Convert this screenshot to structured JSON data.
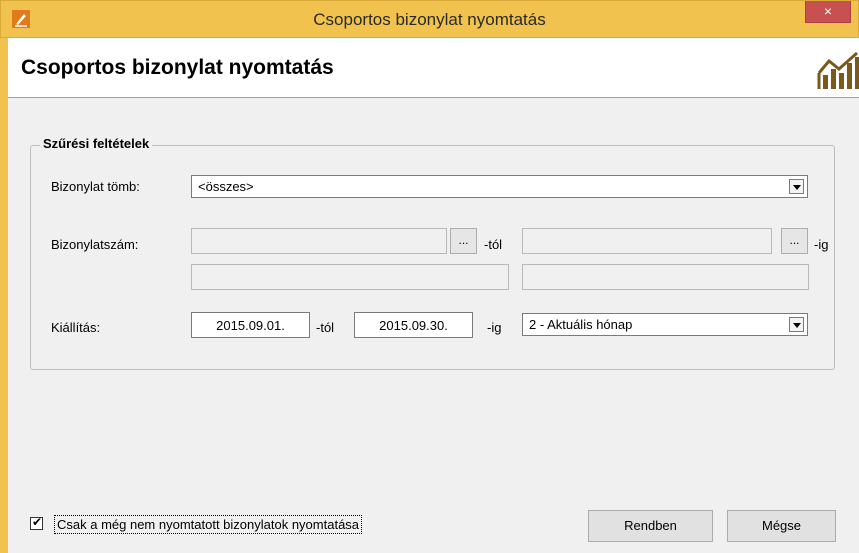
{
  "window": {
    "title": "Csoportos bizonylat nyomtatás",
    "close_glyph": "×"
  },
  "header": {
    "title": "Csoportos bizonylat nyomtatás"
  },
  "filters": {
    "legend": "Szűrési feltételek",
    "block": {
      "label": "Bizonylat tömb:",
      "value": "<összes>"
    },
    "doc_number": {
      "label": "Bizonylatszám:",
      "from_suffix": "-tól",
      "to_suffix": "-ig",
      "browse": "..."
    },
    "issue": {
      "label": "Kiállítás:",
      "from_date": "2015.09.01.",
      "from_suffix": "-tól",
      "to_date": "2015.09.30.",
      "to_suffix": "-ig",
      "period": "2 - Aktuális hónap"
    }
  },
  "footer": {
    "checkbox_label": "Csak a még nem nyomtatott bizonylatok nyomtatása",
    "checkbox_checked": true,
    "ok_label": "Rendben",
    "cancel_label": "Mégse"
  },
  "icons": {
    "app": "pencil-app-icon",
    "header": "chart-icon"
  }
}
